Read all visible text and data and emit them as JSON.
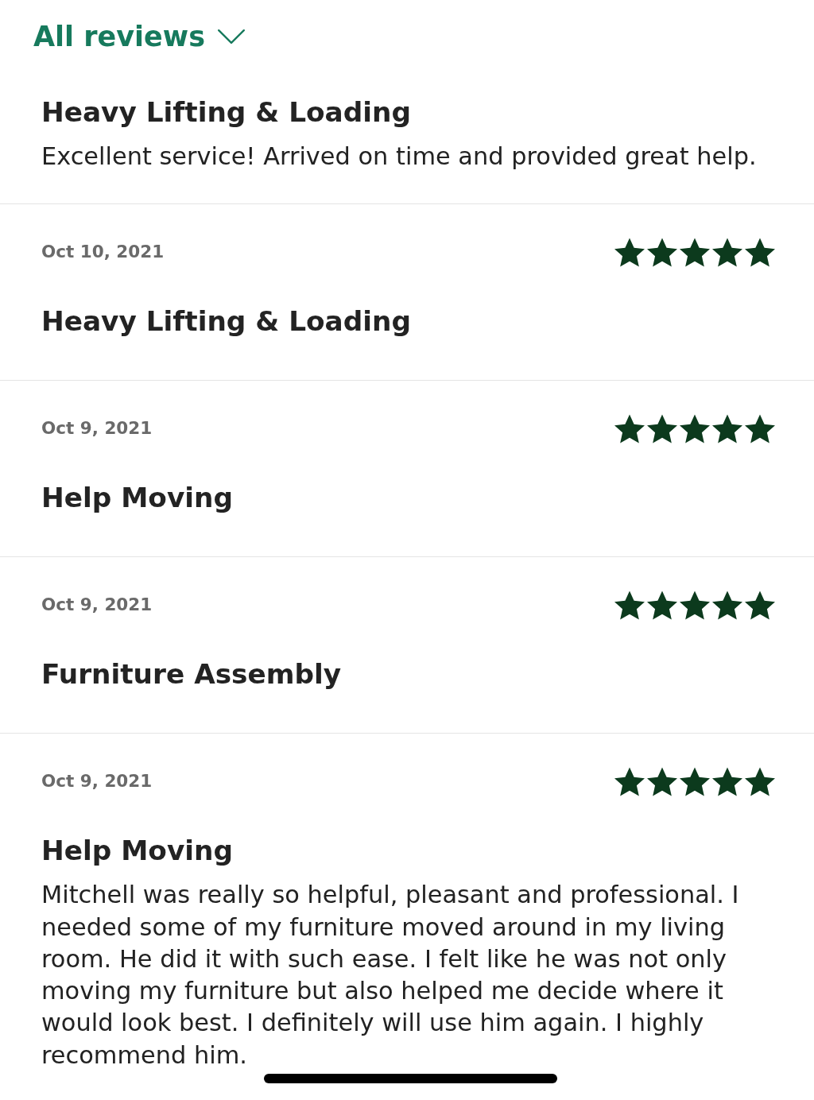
{
  "header": {
    "title": "All reviews"
  },
  "reviews": [
    {
      "title": "Heavy Lifting & Loading",
      "body": "Excellent service! Arrived on time and provided great help."
    },
    {
      "date": "Oct 10, 2021",
      "stars": 5,
      "title": "Heavy Lifting & Loading"
    },
    {
      "date": "Oct 9, 2021",
      "stars": 5,
      "title": "Help Moving"
    },
    {
      "date": "Oct 9, 2021",
      "stars": 5,
      "title": "Furniture Assembly"
    },
    {
      "date": "Oct 9, 2021",
      "stars": 5,
      "title": "Help Moving",
      "body": "Mitchell was really so helpful, pleasant and professional. I needed some of my furniture moved around in my living room. He did it with such ease. I felt like he was not only moving my furniture but also helped me decide where it would look best. I definitely will use him again. I highly recommend him."
    }
  ]
}
